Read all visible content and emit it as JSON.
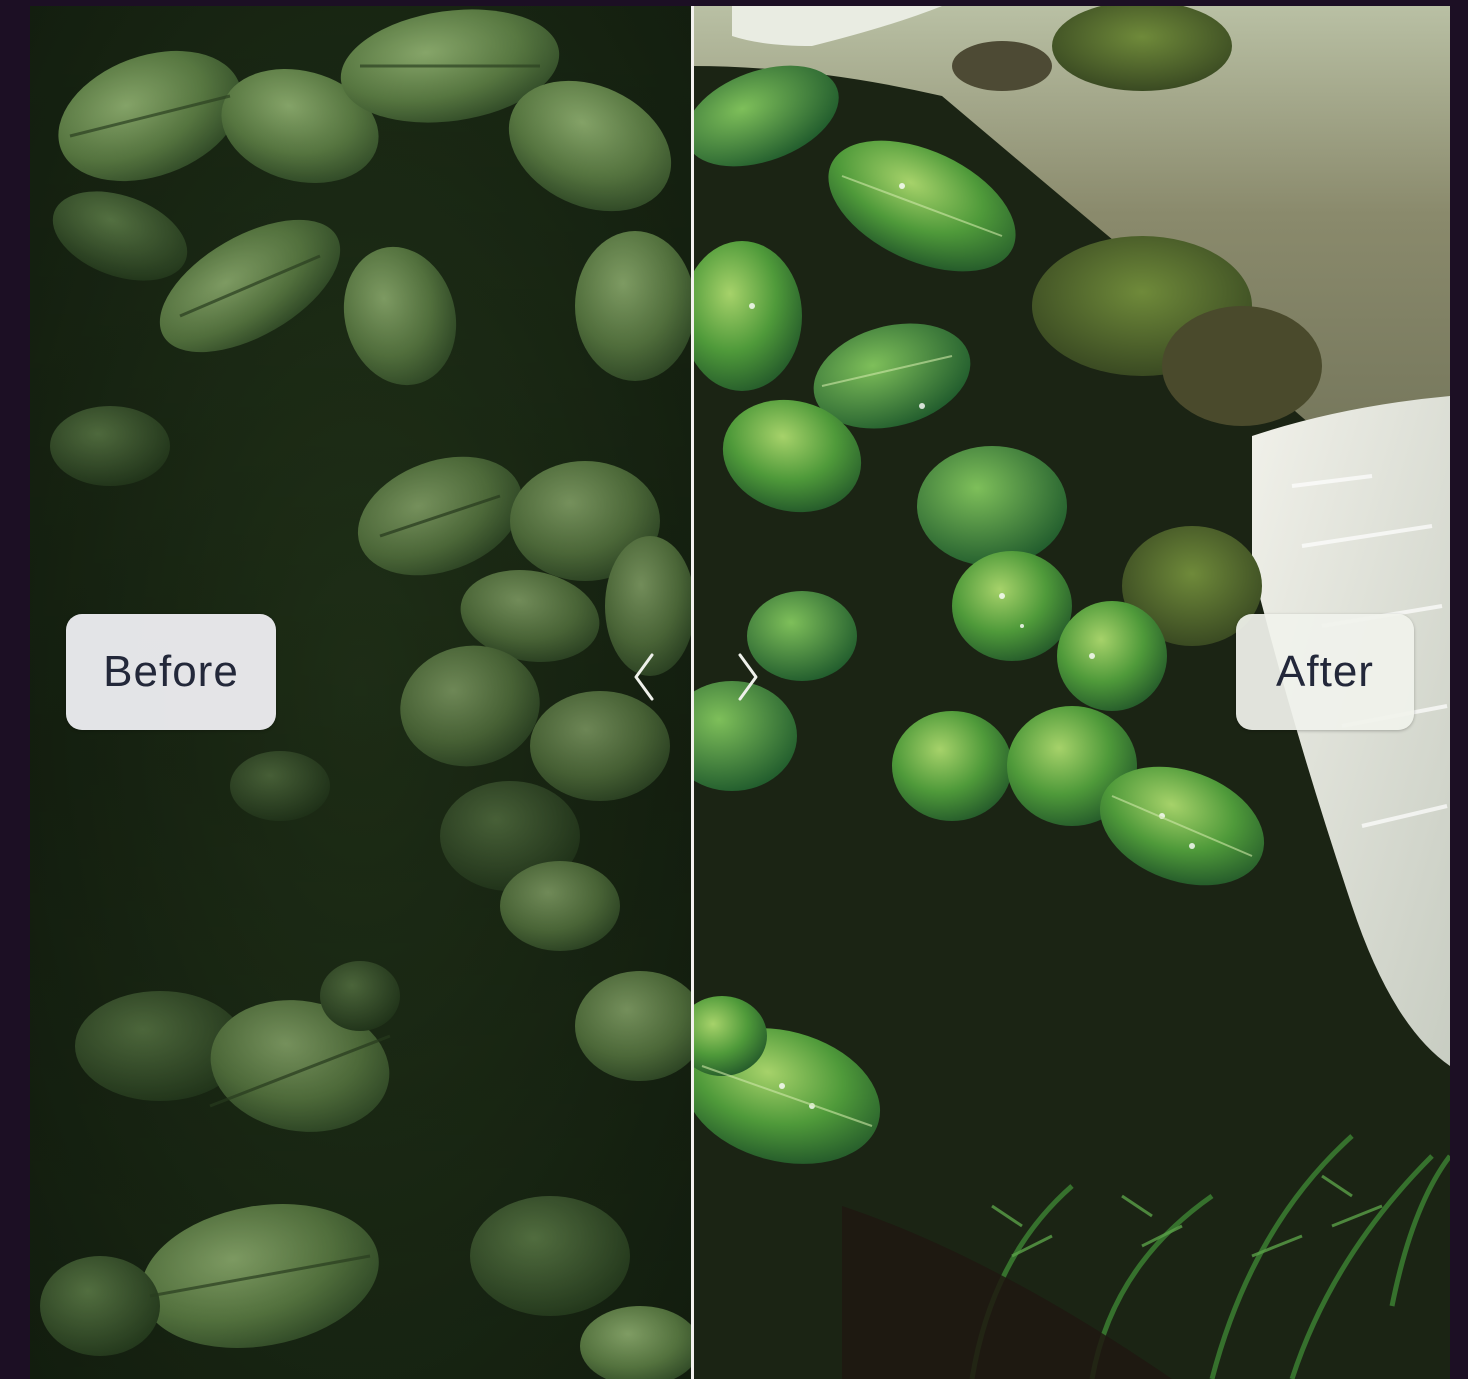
{
  "comparison": {
    "before_label": "Before",
    "after_label": "After",
    "split_position": 0.466
  },
  "icons": {
    "left_handle": "chevron-left-icon",
    "right_handle": "chevron-right-icon"
  },
  "colors": {
    "page_background": "#1c0f24",
    "divider": "#f3f1ee",
    "label_background": "#ececf0",
    "label_text": "#23283a"
  }
}
